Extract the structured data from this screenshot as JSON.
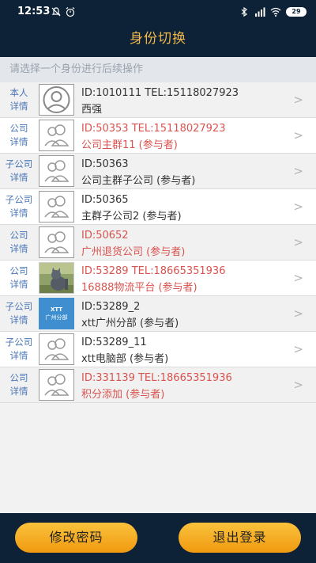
{
  "status": {
    "time": "12:53",
    "battery": "29"
  },
  "header": {
    "title": "身份切换"
  },
  "hint": "请选择一个身份进行后续操作",
  "rows": [
    {
      "role_top": "本人",
      "role_bottom": "详情",
      "line1": "ID:1010111   TEL:15118027923",
      "line2": "西强",
      "red": false,
      "avatar": "person-circle-icon"
    },
    {
      "role_top": "公司",
      "role_bottom": "详情",
      "line1": "ID:50353   TEL:15118027923",
      "line2": "公司主群11 (参与者)",
      "red": true,
      "avatar": "group-icon"
    },
    {
      "role_top": "子公司",
      "role_bottom": "详情",
      "line1": "ID:50363",
      "line2": "公司主群子公司 (参与者)",
      "red": false,
      "avatar": "group-icon"
    },
    {
      "role_top": "子公司",
      "role_bottom": "详情",
      "line1": "ID:50365",
      "line2": "主群子公司2 (参与者)",
      "red": false,
      "avatar": "group-icon"
    },
    {
      "role_top": "公司",
      "role_bottom": "详情",
      "line1": "ID:50652",
      "line2": "广州退货公司 (参与者)",
      "red": true,
      "avatar": "group-icon"
    },
    {
      "role_top": "公司",
      "role_bottom": "详情",
      "line1": "ID:53289   TEL:18665351936",
      "line2": "16888物流平台 (参与者)",
      "red": true,
      "avatar": "cat-photo"
    },
    {
      "role_top": "子公司",
      "role_bottom": "详情",
      "line1": "ID:53289_2",
      "line2": "xtt广州分部 (参与者)",
      "red": false,
      "avatar": "xtt-logo",
      "avatar_text1": "XTT",
      "avatar_text2": "广州分部"
    },
    {
      "role_top": "子公司",
      "role_bottom": "详情",
      "line1": "ID:53289_11",
      "line2": "xtt电脑部 (参与者)",
      "red": false,
      "avatar": "group-icon"
    },
    {
      "role_top": "公司",
      "role_bottom": "详情",
      "line1": "ID:331139   TEL:18665351936",
      "line2": "积分添加 (参与者)",
      "red": true,
      "avatar": "group-icon"
    }
  ],
  "footer": {
    "change_password": "修改密码",
    "logout": "退出登录"
  },
  "colors": {
    "dark": "#0d2236",
    "title": "#f2b84b",
    "red": "#d9534f",
    "role_blue": "#4a76b8",
    "button": "#f5ad25"
  }
}
